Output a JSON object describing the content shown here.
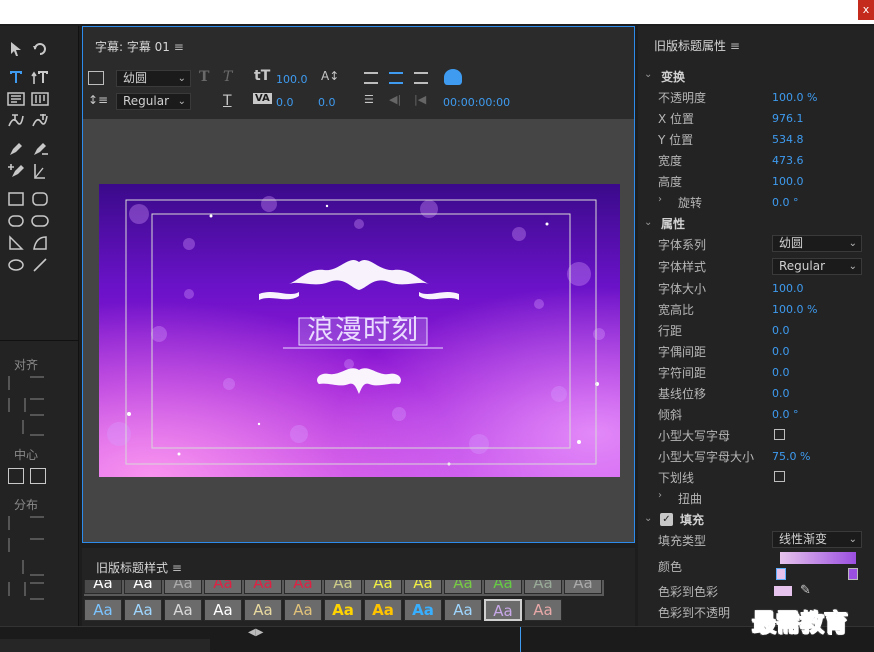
{
  "window": {
    "close_label": "x"
  },
  "tools": {
    "align_label": "对齐",
    "center_label": "中心",
    "distribute_label": "分布"
  },
  "main": {
    "title": "字幕: 字幕 01",
    "font_family": "幼圆",
    "font_style": "Regular",
    "font_size": "100.0",
    "kerning": "0.0",
    "leading": "0.0",
    "timecode": "00:00:00:00",
    "canvas_text": "浪漫时刻"
  },
  "styles": {
    "title": "旧版标题样式",
    "swatch_text": "Aa"
  },
  "props": {
    "title": "旧版标题属性",
    "transform": {
      "label": "变换",
      "opacity_label": "不透明度",
      "opacity": "100.0 %",
      "x_label": "X 位置",
      "x": "976.1",
      "y_label": "Y 位置",
      "y": "534.8",
      "width_label": "宽度",
      "width": "473.6",
      "height_label": "高度",
      "height": "100.0",
      "rotation_label": "旋转",
      "rotation": "0.0 °"
    },
    "properties": {
      "label": "属性",
      "font_family_label": "字体系列",
      "font_family": "幼圆",
      "font_style_label": "字体样式",
      "font_style": "Regular",
      "font_size_label": "字体大小",
      "font_size": "100.0",
      "aspect_label": "宽高比",
      "aspect": "100.0 %",
      "leading_label": "行距",
      "leading": "0.0",
      "kerning_label": "字偶间距",
      "kerning": "0.0",
      "tracking_label": "字符间距",
      "tracking": "0.0",
      "baseline_label": "基线位移",
      "baseline": "0.0",
      "slant_label": "倾斜",
      "slant": "0.0 °",
      "smallcaps_label": "小型大写字母",
      "smallcaps_size_label": "小型大写字母大小",
      "smallcaps_size": "75.0 %",
      "underline_label": "下划线",
      "distort_label": "扭曲"
    },
    "fill": {
      "label": "填充",
      "fill_type_label": "填充类型",
      "fill_type": "线性渐变",
      "color_label": "颜色",
      "color_to_color_label": "色彩到色彩",
      "color_to_opacity_label": "色彩到不透明",
      "gradient_start": "#e6c3ec",
      "gradient_end": "#9b4fe0"
    }
  },
  "watermark": "最需教育",
  "colors": {
    "accent": "#2d8ceb",
    "value_blue": "#3e9bf0"
  }
}
